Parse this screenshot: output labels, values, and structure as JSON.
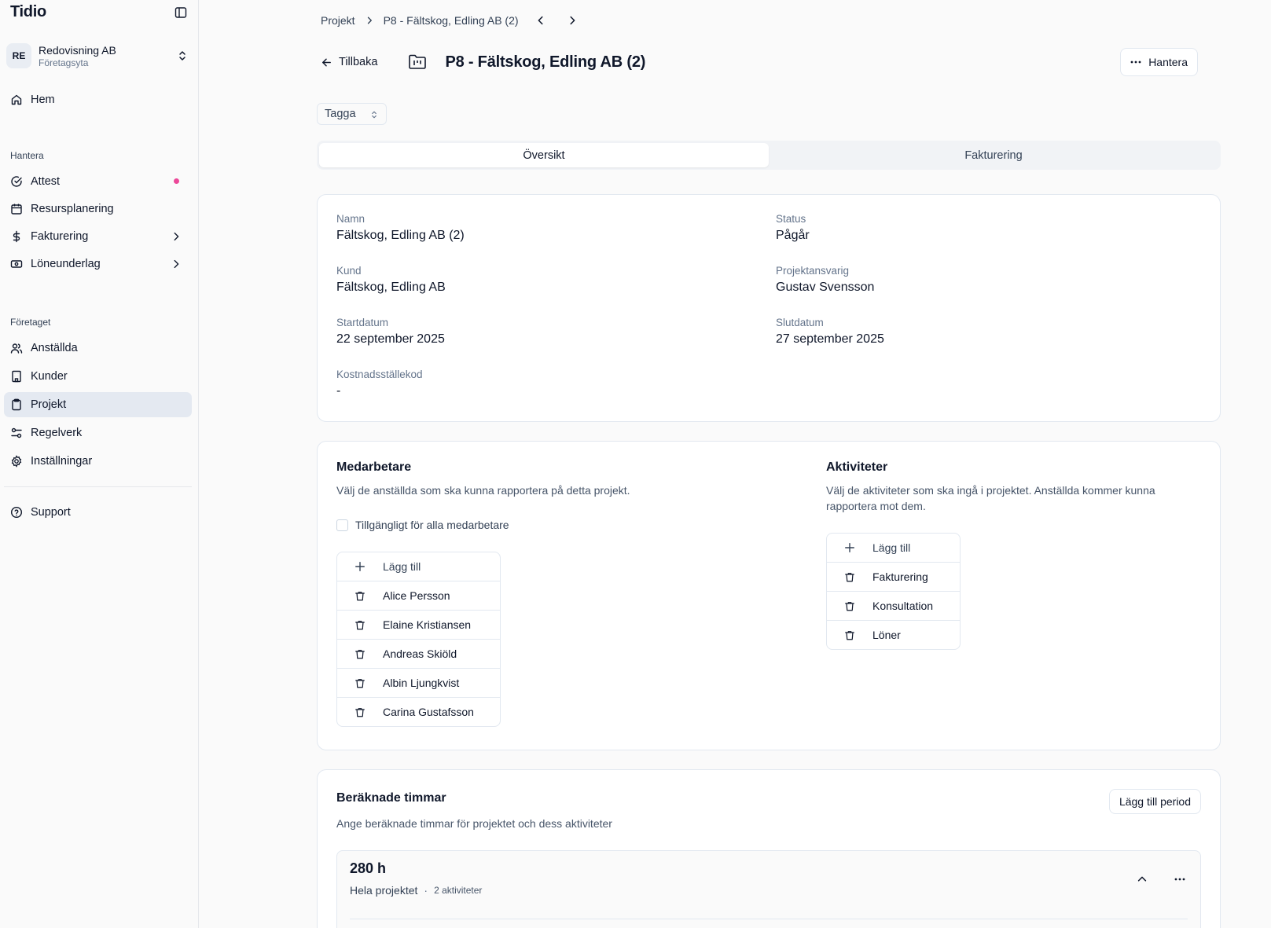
{
  "sidebar": {
    "brand": "Tidio",
    "org": {
      "initials": "RE",
      "name": "Redovisning AB",
      "sub": "Företagsyta"
    },
    "home": "Hem",
    "section_manage": "Hantera",
    "manage_items": [
      {
        "label": "Attest",
        "icon": "check-circle-icon",
        "badge": true
      },
      {
        "label": "Resursplanering",
        "icon": "calendar-icon"
      },
      {
        "label": "Fakturering",
        "icon": "dollar-icon",
        "chevron": true
      },
      {
        "label": "Löneunderlag",
        "icon": "banknote-icon",
        "chevron": true
      }
    ],
    "section_company": "Företaget",
    "company_items": [
      {
        "label": "Anställda",
        "icon": "users-icon"
      },
      {
        "label": "Kunder",
        "icon": "building-icon"
      },
      {
        "label": "Projekt",
        "icon": "clipboard-icon",
        "active": true
      },
      {
        "label": "Regelverk",
        "icon": "sliders-icon"
      },
      {
        "label": "Inställningar",
        "icon": "gear-icon"
      }
    ],
    "support": "Support",
    "badge_color": "#ec4899"
  },
  "breadcrumb": {
    "root": "Projekt",
    "current": "P8 - Fältskog, Edling AB (2)"
  },
  "header": {
    "back": "Tillbaka",
    "title": "P8 - Fältskog, Edling AB (2)",
    "manage": "Hantera"
  },
  "tag": {
    "label": "Tagga"
  },
  "tabs": [
    {
      "label": "Översikt",
      "active": true
    },
    {
      "label": "Fakturering"
    }
  ],
  "info": {
    "name_label": "Namn",
    "name_value": "Fältskog, Edling AB (2)",
    "status_label": "Status",
    "status_value": "Pågår",
    "customer_label": "Kund",
    "customer_value": "Fältskog, Edling AB",
    "manager_label": "Projektansvarig",
    "manager_value": "Gustav Svensson",
    "start_label": "Startdatum",
    "start_value": "22 september 2025",
    "end_label": "Slutdatum",
    "end_value": "27 september 2025",
    "cost_label": "Kostnadsställekod",
    "cost_value": "-"
  },
  "team": {
    "title": "Medarbetare",
    "desc": "Välj de anställda som ska kunna rapportera på detta projekt.",
    "checkbox": "Tillgängligt för alla medarbetare",
    "add": "Lägg till",
    "members": [
      "Alice Persson",
      "Elaine Kristiansen",
      "Andreas Skiöld",
      "Albin Ljungkvist",
      "Carina Gustafsson"
    ]
  },
  "activities": {
    "title": "Aktiviteter",
    "desc": "Välj de aktiviteter som ska ingå i projektet. Anställda kommer kunna rapportera mot dem.",
    "add": "Lägg till",
    "items": [
      "Fakturering",
      "Konsultation",
      "Löner"
    ]
  },
  "hours": {
    "title": "Beräknade timmar",
    "desc": "Ange beräknade timmar för projektet och dess aktiviteter",
    "add_period": "Lägg till period",
    "total": "280 h",
    "scope": "Hela projektet",
    "activity_count": "2 aktiviteter"
  }
}
